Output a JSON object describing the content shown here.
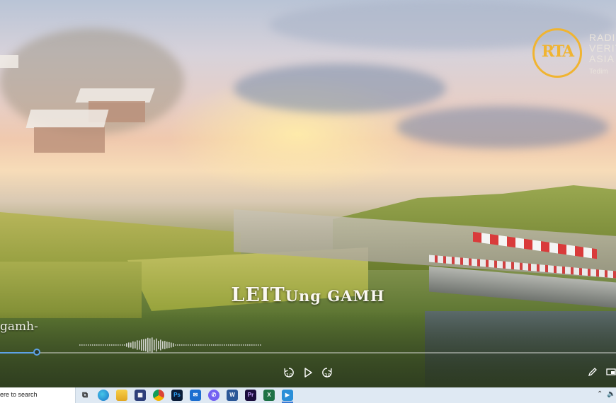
{
  "video": {
    "title_cap1": "LEIT",
    "title_small": "U",
    "title_rest1": "ng G",
    "title_small2": "AMH",
    "side_caption": "gamh-"
  },
  "logo": {
    "mark": "RTA",
    "line1": "RADI",
    "line2": "VERIT",
    "line3": "ASIA",
    "sub": "Tedim"
  },
  "player": {
    "rewind_label": "10",
    "forward_label": "30",
    "progress_fraction": 0.06
  },
  "taskbar": {
    "search_placeholder": "ere to search",
    "apps": [
      "task-view",
      "edge",
      "file-explorer",
      "store",
      "chrome",
      "photoshop",
      "mail",
      "viber",
      "word",
      "premiere",
      "excel",
      "media-player"
    ]
  },
  "colors": {
    "accent": "#5ea2e6",
    "logo_gold": "#f0b431",
    "taskbar_bg": "#dfe9f3"
  }
}
